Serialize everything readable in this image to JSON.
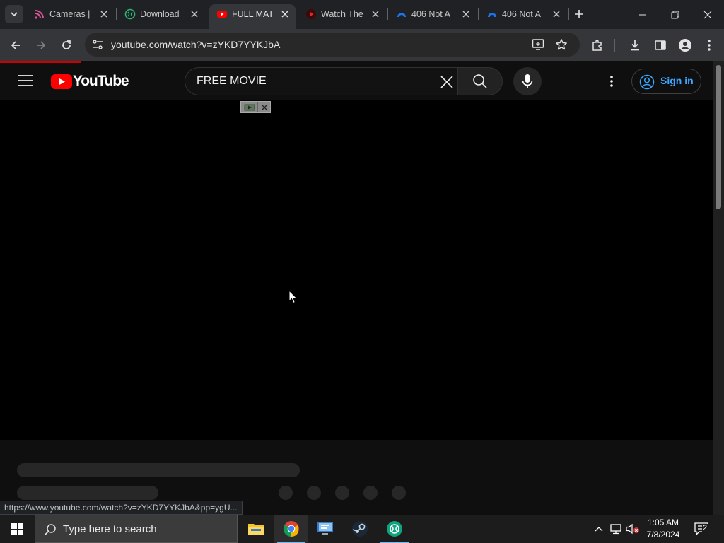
{
  "browser": {
    "tabs": [
      {
        "title": "Cameras |",
        "favicon": "cameras-icon"
      },
      {
        "title": "Download",
        "favicon": "download-site-icon"
      },
      {
        "title": "FULL MATC",
        "favicon": "youtube-icon",
        "active": true
      },
      {
        "title": "Watch The",
        "favicon": "watch-site-icon"
      },
      {
        "title": "406 Not A",
        "favicon": "cloud-icon"
      },
      {
        "title": "406 Not A",
        "favicon": "cloud-icon"
      }
    ],
    "url": "youtube.com/watch?v=zYKD7YYKJbA",
    "status_url": "https://www.youtube.com/watch?v=zYKD7YYKJbA&pp=ygU..."
  },
  "youtube": {
    "logo_text": "YouTube",
    "search_value": "FREE MOVIE",
    "sign_in_label": "Sign in"
  },
  "taskbar": {
    "search_placeholder": "Type here to search",
    "time": "1:05 AM",
    "date": "7/8/2024",
    "notification_count": "2"
  },
  "colors": {
    "youtube_red": "#ff0000",
    "link_blue": "#3ea6ff",
    "chrome_dark": "#202124"
  }
}
